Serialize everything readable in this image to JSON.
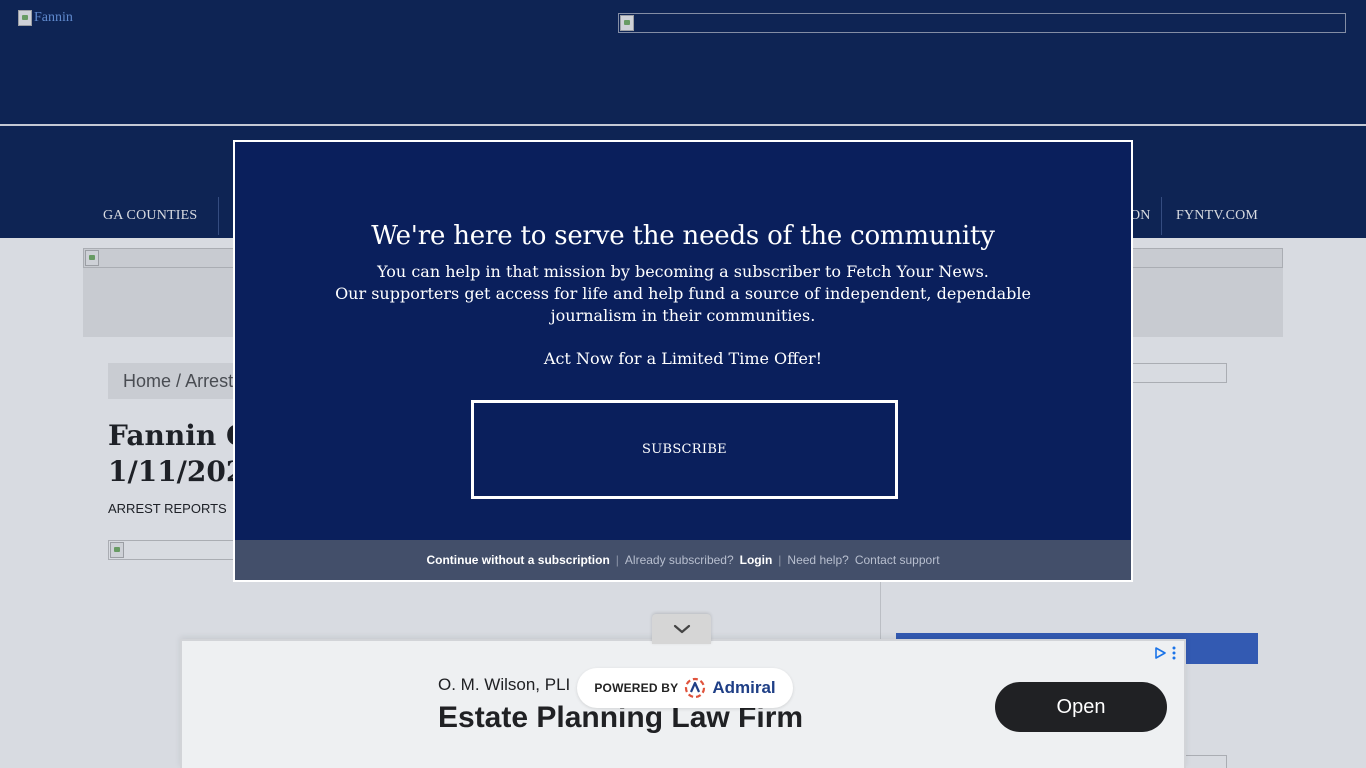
{
  "header": {
    "logo_alt": "Fannin"
  },
  "nav": {
    "items": [
      "GA COUNTIES",
      "ON",
      "FYNTV.COM"
    ]
  },
  "article": {
    "breadcrumb_home": "Home",
    "breadcrumb_sep": "/",
    "breadcrumb_current": "Arrest",
    "title_line1": "Fannin C",
    "title_line2": "1/11/202",
    "category": "ARREST REPORTS"
  },
  "modal": {
    "heading": "We're here to serve the needs of the community",
    "body_line1": "You can help in that mission by becoming a subscriber to Fetch Your News.",
    "body_line2": "Our supporters get access for life and help fund a source of independent, dependable journalism in their communities.",
    "offer": "Act Now for a Limited Time Offer!",
    "subscribe_label": "SUBSCRIBE",
    "footer": {
      "continue_label": "Continue without a subscription",
      "already_text": "Already subscribed?",
      "login_label": "Login",
      "help_text": "Need help?",
      "contact_label": "Contact support",
      "sep": "|"
    }
  },
  "sticky_ad": {
    "advertiser": "O. M. Wilson, PLI",
    "headline": "Estate Planning Law Firm",
    "cta": "Open",
    "powered_by": "POWERED BY",
    "powered_name": "Admiral"
  },
  "colors": {
    "header_navy": "#0f2557",
    "modal_navy": "#0a1f5c",
    "modal_footer": "#434f6a",
    "sidebar_blue": "#3b66c8"
  },
  "icons": {
    "ad_collapse": "chevron-down-icon",
    "ad_choices": "adchoices-icon",
    "ad_menu": "kebab-menu-icon",
    "admiral_logo": "admiral-logo-icon"
  }
}
